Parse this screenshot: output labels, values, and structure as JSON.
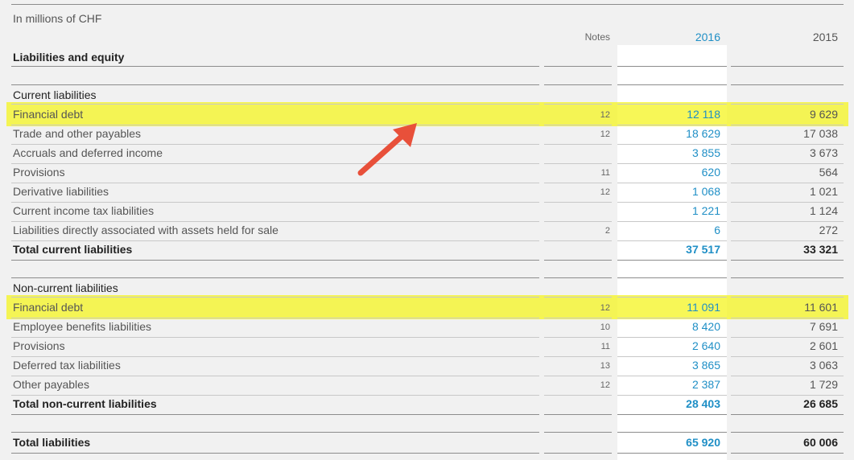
{
  "header": {
    "unit": "In millions of CHF",
    "notes": "Notes",
    "year_current": "2016",
    "year_prior": "2015"
  },
  "rows": [
    {
      "label": "Liabilities and equity",
      "note": "",
      "v2016": "",
      "v2015": "",
      "style": "head-bold"
    },
    {
      "label": "Current liabilities",
      "note": "",
      "v2016": "",
      "v2015": "",
      "style": "head"
    },
    {
      "label": "Financial debt",
      "note": "12",
      "v2016": "12 118",
      "v2015": "9 629",
      "style": "normal"
    },
    {
      "label": "Trade and other payables",
      "note": "12",
      "v2016": "18 629",
      "v2015": "17 038",
      "style": "normal"
    },
    {
      "label": "Accruals and deferred income",
      "note": "",
      "v2016": "3 855",
      "v2015": "3 673",
      "style": "normal"
    },
    {
      "label": "Provisions",
      "note": "11",
      "v2016": "620",
      "v2015": "564",
      "style": "normal"
    },
    {
      "label": "Derivative liabilities",
      "note": "12",
      "v2016": "1 068",
      "v2015": "1 021",
      "style": "normal"
    },
    {
      "label": "Current income tax liabilities",
      "note": "",
      "v2016": "1 221",
      "v2015": "1 124",
      "style": "normal"
    },
    {
      "label": "Liabilities directly associated with assets held for sale",
      "note": "2",
      "v2016": "6",
      "v2015": "272",
      "style": "normal"
    },
    {
      "label": "Total current liabilities",
      "note": "",
      "v2016": "37 517",
      "v2015": "33 321",
      "style": "bold"
    },
    {
      "label": "Non-current liabilities",
      "note": "",
      "v2016": "",
      "v2015": "",
      "style": "head"
    },
    {
      "label": "Financial debt",
      "note": "12",
      "v2016": "11 091",
      "v2015": "11 601",
      "style": "normal"
    },
    {
      "label": "Employee benefits liabilities",
      "note": "10",
      "v2016": "8 420",
      "v2015": "7 691",
      "style": "normal"
    },
    {
      "label": "Provisions",
      "note": "11",
      "v2016": "2 640",
      "v2015": "2 601",
      "style": "normal"
    },
    {
      "label": "Deferred tax liabilities",
      "note": "13",
      "v2016": "3 865",
      "v2015": "3 063",
      "style": "normal"
    },
    {
      "label": "Other payables",
      "note": "12",
      "v2016": "2 387",
      "v2015": "1 729",
      "style": "normal"
    },
    {
      "label": "Total non-current liabilities",
      "note": "",
      "v2016": "28 403",
      "v2015": "26 685",
      "style": "bold"
    },
    {
      "label": "Total liabilities",
      "note": "",
      "v2016": "65 920",
      "v2015": "60 006",
      "style": "bold"
    }
  ],
  "colors": {
    "highlight": "#f5f528",
    "accent_blue": "#1f8fc6",
    "arrow": "#e8503a"
  },
  "icons": {
    "annotation": "red-arrow-icon"
  }
}
